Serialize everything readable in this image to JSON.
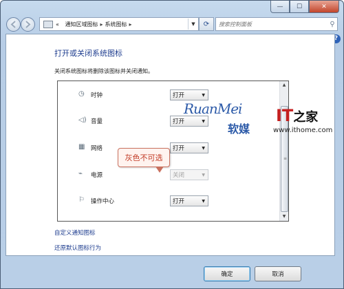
{
  "titlebar": {
    "buttons": [
      "—",
      "☐",
      "✕"
    ]
  },
  "nav": {
    "breadcrumb": [
      "«",
      "通知区域图标",
      "系统图标"
    ],
    "search_placeholder": "搜索控制面板"
  },
  "main": {
    "title": "打开或关闭系统图标",
    "description": "关闭系统图标将删除该图标并关闭通知。",
    "rows": [
      {
        "icon": "clock-icon",
        "label": "时钟",
        "value": "打开",
        "disabled": false
      },
      {
        "icon": "speaker-icon",
        "label": "音量",
        "value": "打开",
        "disabled": false
      },
      {
        "icon": "network-icon",
        "label": "网络",
        "value": "打开",
        "disabled": false
      },
      {
        "icon": "power-icon",
        "label": "电源",
        "value": "关闭",
        "disabled": true
      },
      {
        "icon": "flag-icon",
        "label": "操作中心",
        "value": "打开",
        "disabled": false
      }
    ],
    "callout": "灰色不可选",
    "links": [
      "自定义通知图标",
      "还原默认图标行为"
    ]
  },
  "footer": {
    "ok": "确定",
    "cancel": "取消"
  },
  "watermark": {
    "ruanmei_latin": "RuanMei",
    "ruanmei_cn": "软媒",
    "ithome_it": "IT",
    "ithome_cn": "之家",
    "ithome_url": "www.ithome.com"
  }
}
